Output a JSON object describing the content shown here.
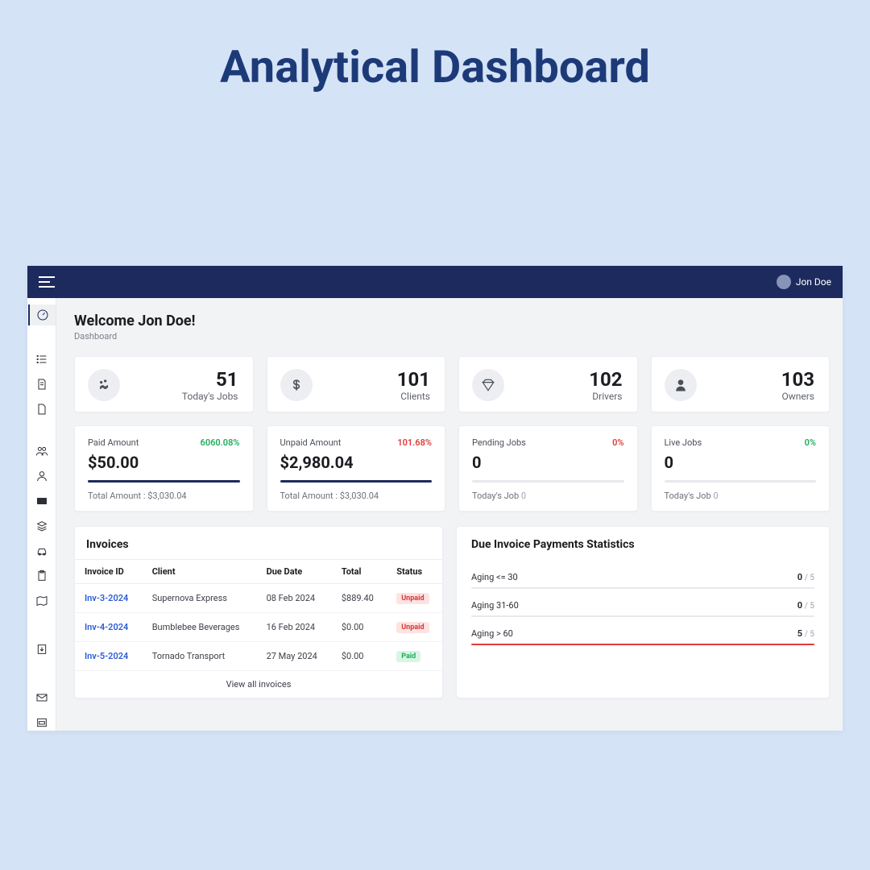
{
  "page_heading": "Analytical Dashboard",
  "topbar": {
    "user_name": "Jon Doe"
  },
  "header": {
    "welcome": "Welcome Jon Doe!",
    "breadcrumb": "Dashboard"
  },
  "stats": [
    {
      "value": "51",
      "label": "Today's Jobs"
    },
    {
      "value": "101",
      "label": "Clients"
    },
    {
      "value": "102",
      "label": "Drivers"
    },
    {
      "value": "103",
      "label": "Owners"
    }
  ],
  "metrics": {
    "paid": {
      "title": "Paid Amount",
      "pct": "6060.08%",
      "pct_color": "green",
      "value": "$50.00",
      "bar": 100,
      "sub_label": "Total Amount : ",
      "sub_value": "$3,030.04"
    },
    "unpaid": {
      "title": "Unpaid Amount",
      "pct": "101.68%",
      "pct_color": "red",
      "value": "$2,980.04",
      "bar": 100,
      "sub_label": "Total Amount : ",
      "sub_value": "$3,030.04"
    },
    "pending": {
      "title": "Pending Jobs",
      "pct": "0%",
      "pct_color": "red",
      "value": "0",
      "bar": 0,
      "sub_label": "Today's Job ",
      "sub_value": "0"
    },
    "live": {
      "title": "Live Jobs",
      "pct": "0%",
      "pct_color": "green",
      "value": "0",
      "bar": 0,
      "sub_label": "Today's Job ",
      "sub_value": "0"
    }
  },
  "invoices": {
    "title": "Invoices",
    "columns": [
      "Invoice ID",
      "Client",
      "Due Date",
      "Total",
      "Status"
    ],
    "rows": [
      {
        "id": "Inv-3-2024",
        "client": "Supernova Express",
        "due": "08 Feb 2024",
        "total": "$889.40",
        "status": "Unpaid"
      },
      {
        "id": "Inv-4-2024",
        "client": "Bumblebee Beverages",
        "due": "16 Feb 2024",
        "total": "$0.00",
        "status": "Unpaid"
      },
      {
        "id": "Inv-5-2024",
        "client": "Tornado Transport",
        "due": "27 May 2024",
        "total": "$0.00",
        "status": "Paid"
      }
    ],
    "view_all": "View all invoices"
  },
  "aging": {
    "title": "Due Invoice Payments Statistics",
    "total": 5,
    "buckets": [
      {
        "label": "Aging <= 30",
        "count": 0
      },
      {
        "label": "Aging 31-60",
        "count": 0
      },
      {
        "label": "Aging > 60",
        "count": 5
      }
    ]
  }
}
